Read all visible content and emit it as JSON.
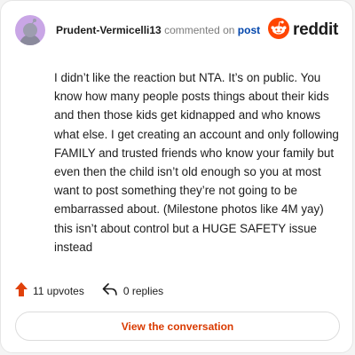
{
  "comment": {
    "username": "Prudent-Vermicelli13",
    "action_text": "commented on",
    "target_link": "post",
    "body": "I didn’t like the reaction but NTA. It’s on public. You know how many people posts things about their kids and then those kids get kidnapped and who knows what else. I get creating an account and only following FAMILY and trusted friends who know your family but even then the child isn’t old enough so you at most want to post something they’re not going to be embarrassed about. (Milestone photos like 4M yay) this isn’t about control but a HUGE SAFETY issue instead"
  },
  "brand": {
    "logo_text": "reddit",
    "logo_icon": "reddit-alien-icon",
    "accent_color": "#ff4500"
  },
  "stats": {
    "upvotes": "11 upvotes",
    "replies": "0 replies",
    "upvote_icon": "upvote-arrow-icon",
    "reply_icon": "reply-arrow-icon"
  },
  "actions": {
    "view_conversation": "View the conversation"
  },
  "avatar": {
    "icon": "user-avatar-icon",
    "background": "#c9a6e6"
  }
}
